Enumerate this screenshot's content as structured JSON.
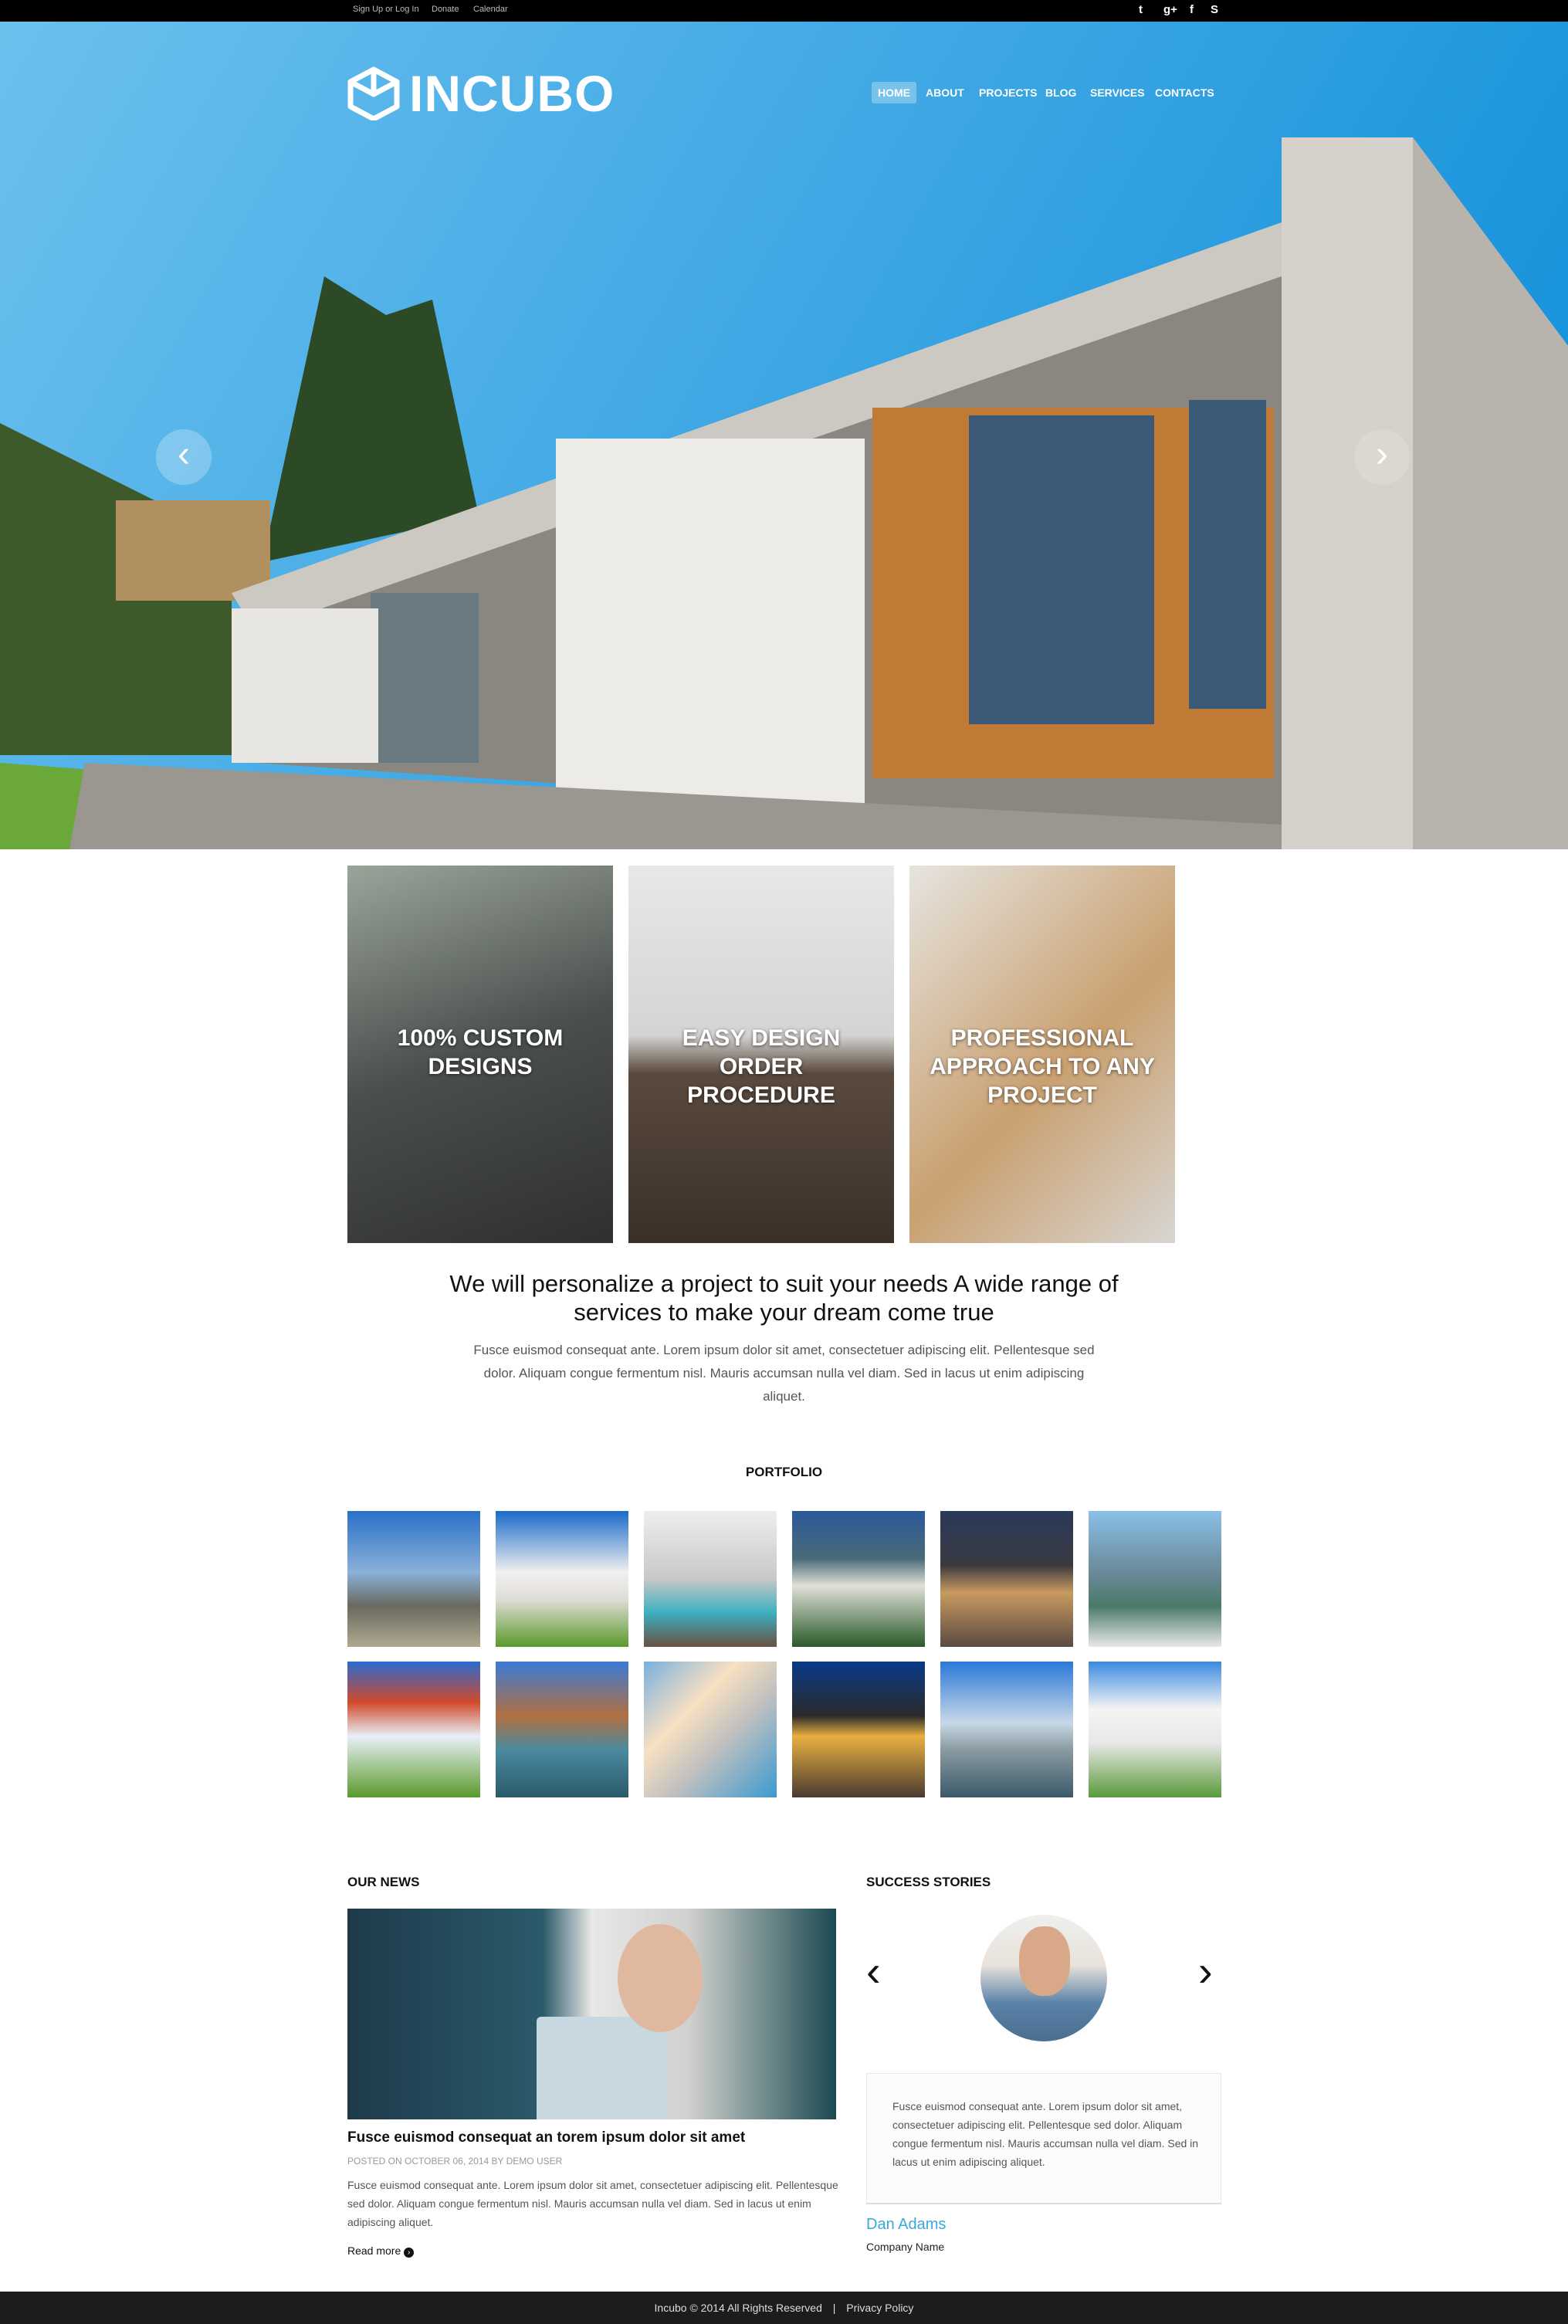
{
  "topbar": {
    "links": [
      "Sign Up or Log In",
      "Donate",
      "Calendar"
    ],
    "social": [
      "twitter-icon",
      "google-plus-icon",
      "facebook-icon",
      "skype-icon"
    ]
  },
  "header": {
    "logo": "INCUBO",
    "nav": [
      "HOME",
      "ABOUT",
      "PROJECTS",
      "BLOG",
      "SERVICES",
      "CONTACTS"
    ],
    "active": "HOME"
  },
  "features": [
    "100% CUSTOM DESIGNS",
    "EASY DESIGN ORDER PROCEDURE",
    "PROFESSIONAL APPROACH TO ANY PROJECT"
  ],
  "intro": {
    "heading": "We will personalize a project to suit your needs A wide range of services to make your dream come true",
    "text": "Fusce euismod consequat ante. Lorem ipsum dolor sit amet, consectetuer adipiscing elit. Pellentesque sed dolor. Aliquam congue fermentum nisl. Mauris accumsan nulla vel diam. Sed in lacus ut enim adipiscing aliquet."
  },
  "portfolio": {
    "title": "PORTFOLIO"
  },
  "news": {
    "title": "OUR NEWS",
    "post_title": "Fusce euismod consequat an torem ipsum dolor sit amet",
    "meta": "POSTED ON OCTOBER 06, 2014 BY DEMO USER",
    "text": "Fusce euismod consequat ante. Lorem ipsum dolor sit amet, consectetuer adipiscing elit. Pellentesque sed dolor. Aliquam congue fermentum nisl. Mauris accumsan nulla vel diam. Sed in lacus ut enim adipiscing aliquet.",
    "read_more": "Read more"
  },
  "stories": {
    "title": "SUCCESS STORIES",
    "quote": "Fusce euismod consequat ante. Lorem ipsum dolor sit amet, consectetuer adipiscing elit. Pellentesque sed dolor. Aliquam congue fermentum nisl. Mauris accumsan nulla vel diam. Sed in lacus ut enim adipiscing aliquet.",
    "name": "Dan Adams",
    "company": "Company Name"
  },
  "footer": {
    "copyright": "Incubo © 2014 All Rights Reserved",
    "separator": "|",
    "privacy": "Privacy Policy"
  },
  "colors": {
    "accent": "#3aa8db",
    "sky": "#1d9be0",
    "footer": "#1c1c1c"
  }
}
